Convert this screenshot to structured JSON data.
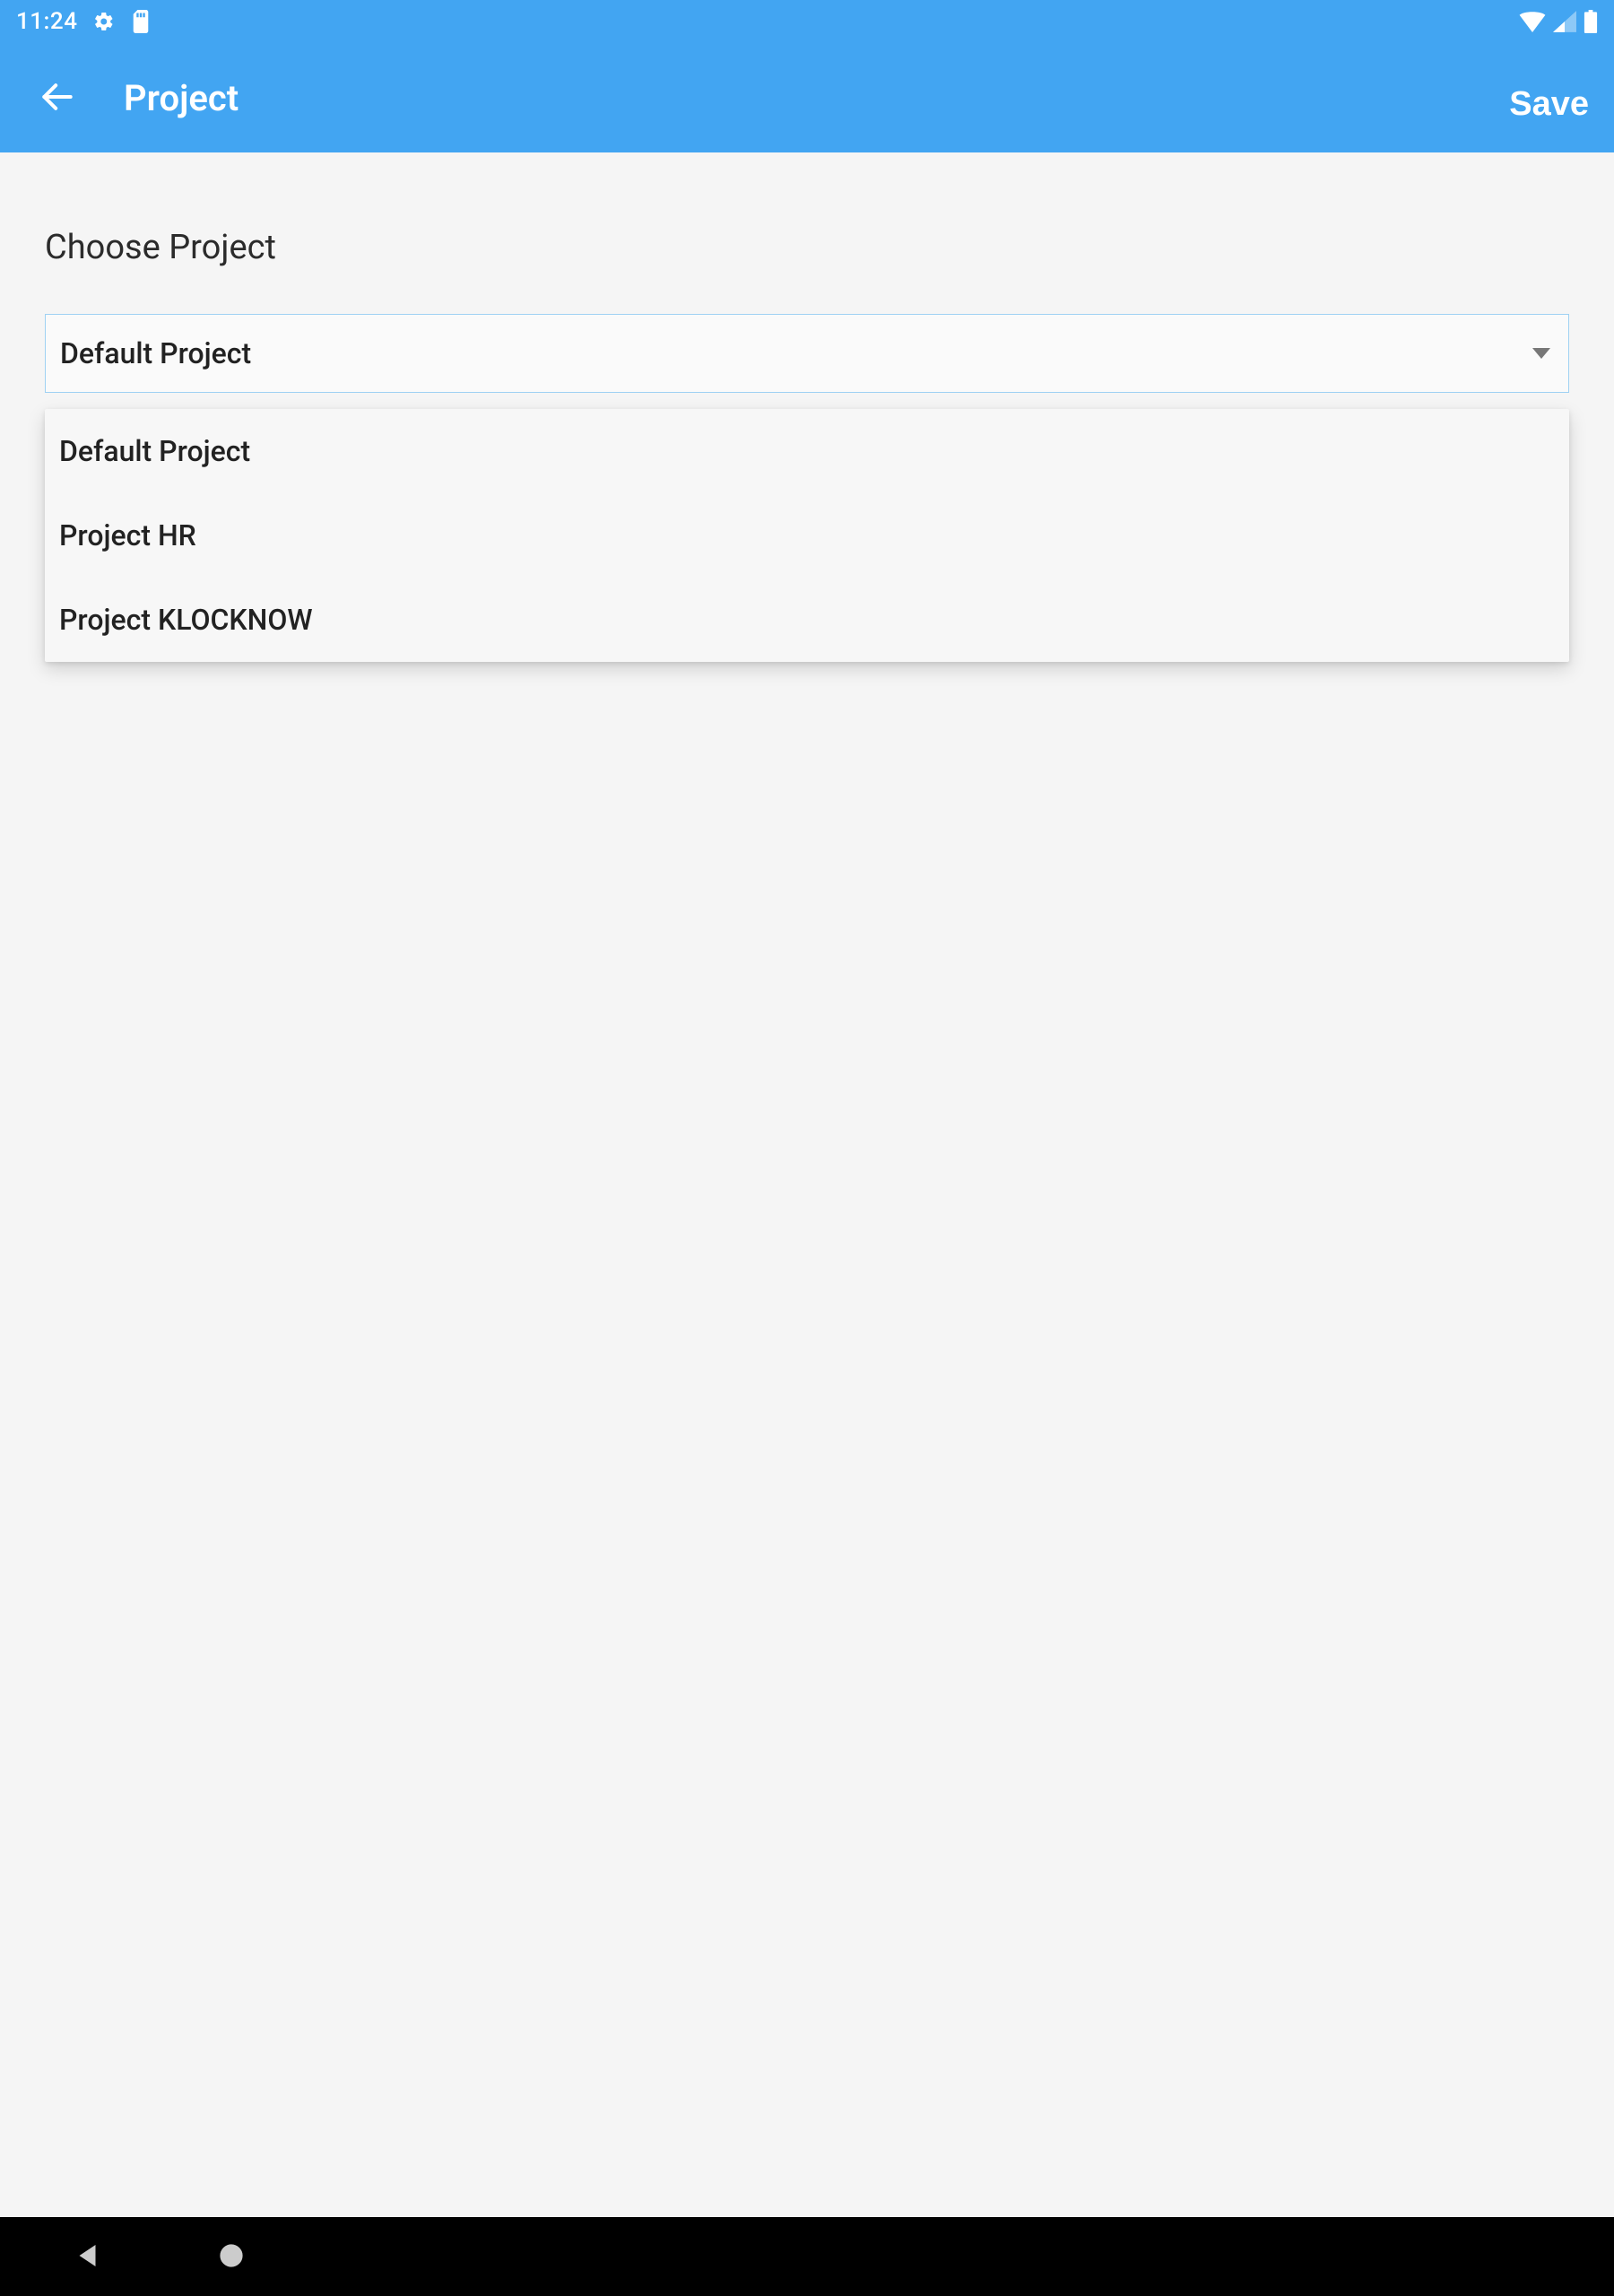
{
  "status": {
    "time": "11:24"
  },
  "appbar": {
    "title": "Project",
    "save_label": "Save"
  },
  "section": {
    "label": "Choose Project"
  },
  "select": {
    "value": "Default Project"
  },
  "dropdown": {
    "options": [
      {
        "label": "Default Project"
      },
      {
        "label": "Project HR"
      },
      {
        "label": "Project KLOCKNOW"
      }
    ]
  }
}
